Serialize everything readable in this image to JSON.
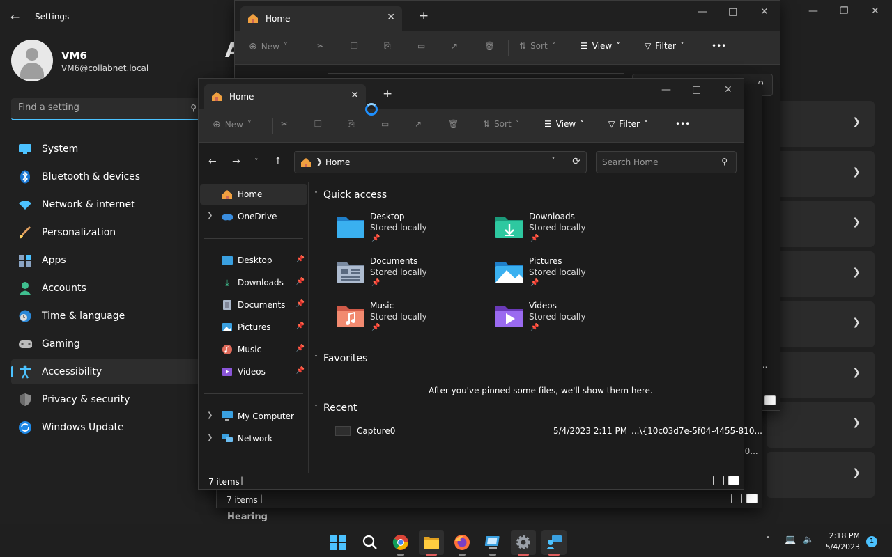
{
  "settings": {
    "app_title": "Settings",
    "user_name": "VM6",
    "user_email": "VM6@collabnet.local",
    "search_placeholder": "Find a setting",
    "nav": [
      {
        "label": "System",
        "icon": "monitor-icon"
      },
      {
        "label": "Bluetooth & devices",
        "icon": "bluetooth-icon"
      },
      {
        "label": "Network & internet",
        "icon": "wifi-icon"
      },
      {
        "label": "Personalization",
        "icon": "brush-icon"
      },
      {
        "label": "Apps",
        "icon": "apps-icon"
      },
      {
        "label": "Accounts",
        "icon": "person-icon"
      },
      {
        "label": "Time & language",
        "icon": "globe-clock-icon"
      },
      {
        "label": "Gaming",
        "icon": "gamepad-icon"
      },
      {
        "label": "Accessibility",
        "icon": "accessibility-icon"
      },
      {
        "label": "Privacy & security",
        "icon": "shield-icon"
      },
      {
        "label": "Windows Update",
        "icon": "update-icon"
      }
    ],
    "active_item": "Accessibility",
    "heading_fragment": "A",
    "hearing_label": "Hearing",
    "truncated_texts": [
      "55-810...",
      "10..."
    ]
  },
  "back_explorer": {
    "tab_title": "Home",
    "toolbar": {
      "new": "New",
      "sort": "Sort",
      "view": "View",
      "filter": "Filter"
    },
    "status_text": "7 items"
  },
  "explorer": {
    "tab_title": "Home",
    "toolbar": {
      "new": "New",
      "sort": "Sort",
      "view": "View",
      "filter": "Filter",
      "more": "•••"
    },
    "address": {
      "path": "Home"
    },
    "search_placeholder": "Search Home",
    "sidebar": {
      "home": "Home",
      "onedrive": "OneDrive",
      "pinned": [
        "Desktop",
        "Downloads",
        "Documents",
        "Pictures",
        "Music",
        "Videos"
      ],
      "my_computer": "My Computer",
      "network": "Network"
    },
    "quick_access": {
      "title": "Quick access",
      "items": [
        {
          "name": "Desktop",
          "sub": "Stored locally"
        },
        {
          "name": "Downloads",
          "sub": "Stored locally"
        },
        {
          "name": "Documents",
          "sub": "Stored locally"
        },
        {
          "name": "Pictures",
          "sub": "Stored locally"
        },
        {
          "name": "Music",
          "sub": "Stored locally"
        },
        {
          "name": "Videos",
          "sub": "Stored locally"
        }
      ]
    },
    "favorites": {
      "title": "Favorites",
      "empty_text": "After you've pinned some files, we'll show them here."
    },
    "recent": {
      "title": "Recent",
      "items": [
        {
          "name": "Capture0",
          "date": "5/4/2023 2:11 PM",
          "path": "...\\{10c03d7e-5f04-4455-810..."
        }
      ]
    },
    "status_text": "7 items"
  },
  "taskbar": {
    "time": "2:18 PM",
    "date": "5/4/2023",
    "notification_count": "1"
  },
  "colors": {
    "accent": "#4cc2ff",
    "background": "#202020",
    "explorer_bg": "#1c1c1c"
  }
}
